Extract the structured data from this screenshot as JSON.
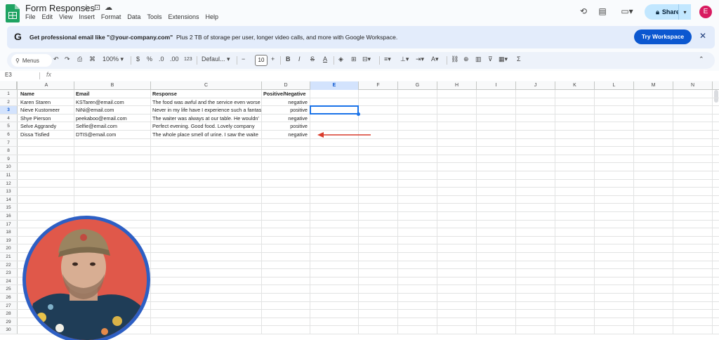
{
  "titlebar": {
    "doc_title": "Form Responses",
    "menus": [
      "File",
      "Edit",
      "View",
      "Insert",
      "Format",
      "Data",
      "Tools",
      "Extensions",
      "Help"
    ],
    "share_label": "Share",
    "user_initial": "E"
  },
  "banner": {
    "lead": "Get professional email like \"@your-company.com\"",
    "rest": "Plus 2 TB of storage per user, longer video calls, and more with Google Workspace.",
    "button": "Try Workspace"
  },
  "toolbar": {
    "search_label": "Menus",
    "zoom": "100%",
    "currency": "$",
    "percent": "%",
    "dec_less": ".0",
    "dec_more": ".00",
    "number_format": "123",
    "font": "Defaul...",
    "font_size": "10",
    "bold": "B",
    "italic": "I",
    "strike": "S",
    "text_color": "A",
    "functions": "Σ"
  },
  "formula_bar": {
    "name_box": "E3",
    "fx": "fx"
  },
  "grid": {
    "columns": [
      "A",
      "B",
      "C",
      "D",
      "E",
      "F",
      "G",
      "H",
      "I",
      "J",
      "K",
      "L",
      "M",
      "N"
    ],
    "selected_column": "E",
    "selected_row": "3",
    "row_count": 30,
    "rows": [
      [
        "Name",
        "Email",
        "Response",
        "Positive/Negative"
      ],
      [
        "Karen Staren",
        "KSTaren@email.com",
        "The food was awful and the service even worse",
        "negative"
      ],
      [
        "Nieve Kustomeer",
        "NiNi@email.com",
        "Never in my life have I experience such a fantas",
        "positive"
      ],
      [
        "Shye Pierson",
        "peekaboo@email.com",
        "The waiter was always at our table.  He wouldn'",
        "negative"
      ],
      [
        "Selve Aggrandy",
        "Selfie@email.com",
        "Perfect evening.  Good food.  Lovely company",
        "positive"
      ],
      [
        "Dissa Tisfied",
        "DTIS@email.com",
        "The whole place smell of urine.  I saw the waite",
        "negative"
      ]
    ]
  },
  "colors": {
    "accent": "#0b57d0",
    "share_bg": "#c2e7ff",
    "arrow": "#d93b2b",
    "cam_border": "#2d5fc4",
    "cam_bg": "#e0584a"
  }
}
